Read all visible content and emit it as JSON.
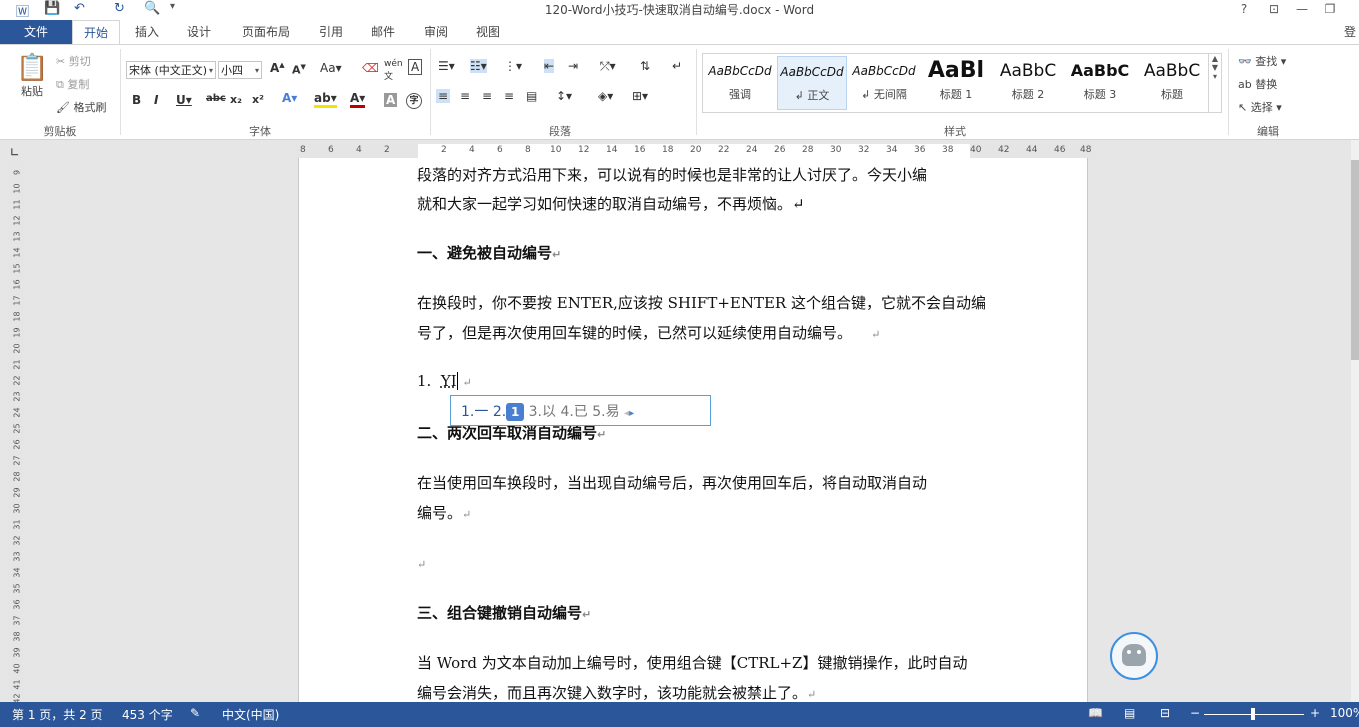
{
  "window": {
    "title": "120-Word小技巧-快速取消自动编号.docx - Word",
    "help": "?",
    "ribbon_display": "⊡",
    "minimize": "—",
    "restore": "❐",
    "signin": "登"
  },
  "tabs": [
    "文件",
    "开始",
    "插入",
    "设计",
    "页面布局",
    "引用",
    "邮件",
    "审阅",
    "视图"
  ],
  "ribbon": {
    "clipboard": {
      "paste": "粘贴",
      "cut": "剪切",
      "copy": "复制",
      "format_painter": "格式刷",
      "group": "剪贴板"
    },
    "font": {
      "name": "宋体 (中文正文)",
      "size": "小四",
      "group": "字体"
    },
    "paragraph": {
      "group": "段落"
    },
    "styles": {
      "group": "样式",
      "items": [
        {
          "preview": "AaBbCcDd",
          "name": "强调"
        },
        {
          "preview": "AaBbCcDd",
          "name": "↲ 正文"
        },
        {
          "preview": "AaBbCcDd",
          "name": "↲ 无间隔"
        },
        {
          "preview": "AaBl",
          "name": "标题 1"
        },
        {
          "preview": "AaBbC",
          "name": "标题 2"
        },
        {
          "preview": "AaBbC",
          "name": "标题 3"
        },
        {
          "preview": "AaBbC",
          "name": "标题"
        }
      ]
    },
    "editing": {
      "find": "查找",
      "replace": "替换",
      "select": "选择",
      "group": "编辑"
    }
  },
  "ruler": {
    "h_ticks": [
      "8",
      "6",
      "4",
      "2",
      "",
      "2",
      "4",
      "6",
      "8",
      "10",
      "12",
      "14",
      "16",
      "18",
      "20",
      "22",
      "24",
      "26",
      "28",
      "30",
      "32",
      "34",
      "36",
      "38",
      "40",
      "42",
      "44",
      "46",
      "48"
    ],
    "v_ticks": [
      "9",
      "10",
      "11",
      "12",
      "13",
      "14",
      "15",
      "16",
      "17",
      "18",
      "19",
      "20",
      "21",
      "22",
      "23",
      "24",
      "25",
      "26",
      "27",
      "28",
      "29",
      "30",
      "31",
      "32",
      "33",
      "34",
      "35",
      "36",
      "37",
      "38",
      "39",
      "40",
      "41",
      "42"
    ]
  },
  "document": {
    "p0a": "段落的对齐方式沿用下来，可以说有的时候也是非常的让人讨厌了。今天小编",
    "p0b": "就和大家一起学习如何快速的取消自动编号，不再烦恼。↵",
    "h1": "一、避免被自动编号",
    "p1a": "在换段时，你不要按 ENTER,应该按 SHIFT+ENTER 这个组合键，它就不会自动编",
    "p1b": "号了，但是再次使用回车键的时候，已然可以延续使用自动编号。",
    "list_num": "1.",
    "list_text": "YI",
    "h2": "二、两次回车取消自动编号",
    "p2a": "在当使用回车换段时，当出现自动编号后，再次使用回车后，将自动取消自动",
    "p2b": "编号。",
    "h3": "三、组合键撤销自动编号",
    "p3a": "当 Word 为文本自动加上编号时，使用组合键【CTRL+Z】键撤销操作，此时自动",
    "p3b": "编号会消失，而且再次键入数字时，该功能就会被禁止了。",
    "para_mark": "↵"
  },
  "ime": {
    "c1": "1.一",
    "c2": "2.",
    "c2_badge": "1",
    "c3": "3.以",
    "c4": "4.已",
    "c5": "5.易"
  },
  "status": {
    "page": "第 1 页，共 2 页",
    "words": "453 个字",
    "lang": "中文(中国)",
    "zoom": "100%"
  }
}
